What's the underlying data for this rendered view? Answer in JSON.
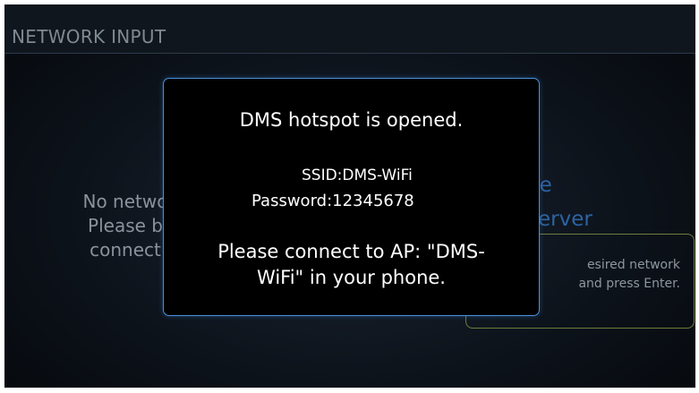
{
  "header": {
    "title": "NETWORK INPUT"
  },
  "background": {
    "left_lines": [
      "No netwo",
      "Please b",
      "connect"
    ],
    "right_lines": [
      "hare",
      "a Server"
    ],
    "box_lines": [
      "esired network",
      "and press Enter."
    ]
  },
  "dialog": {
    "heading": "DMS hotspot is opened.",
    "ssid": "SSID:DMS-WiFi",
    "password": "Password:12345678",
    "message_line1": "Please connect to AP: \"DMS-",
    "message_line2": "WiFi\" in your phone."
  },
  "colors": {
    "accent_border": "#4d8fd6",
    "dim_link": "#2d63a3",
    "box_border": "#6e7d3a"
  }
}
